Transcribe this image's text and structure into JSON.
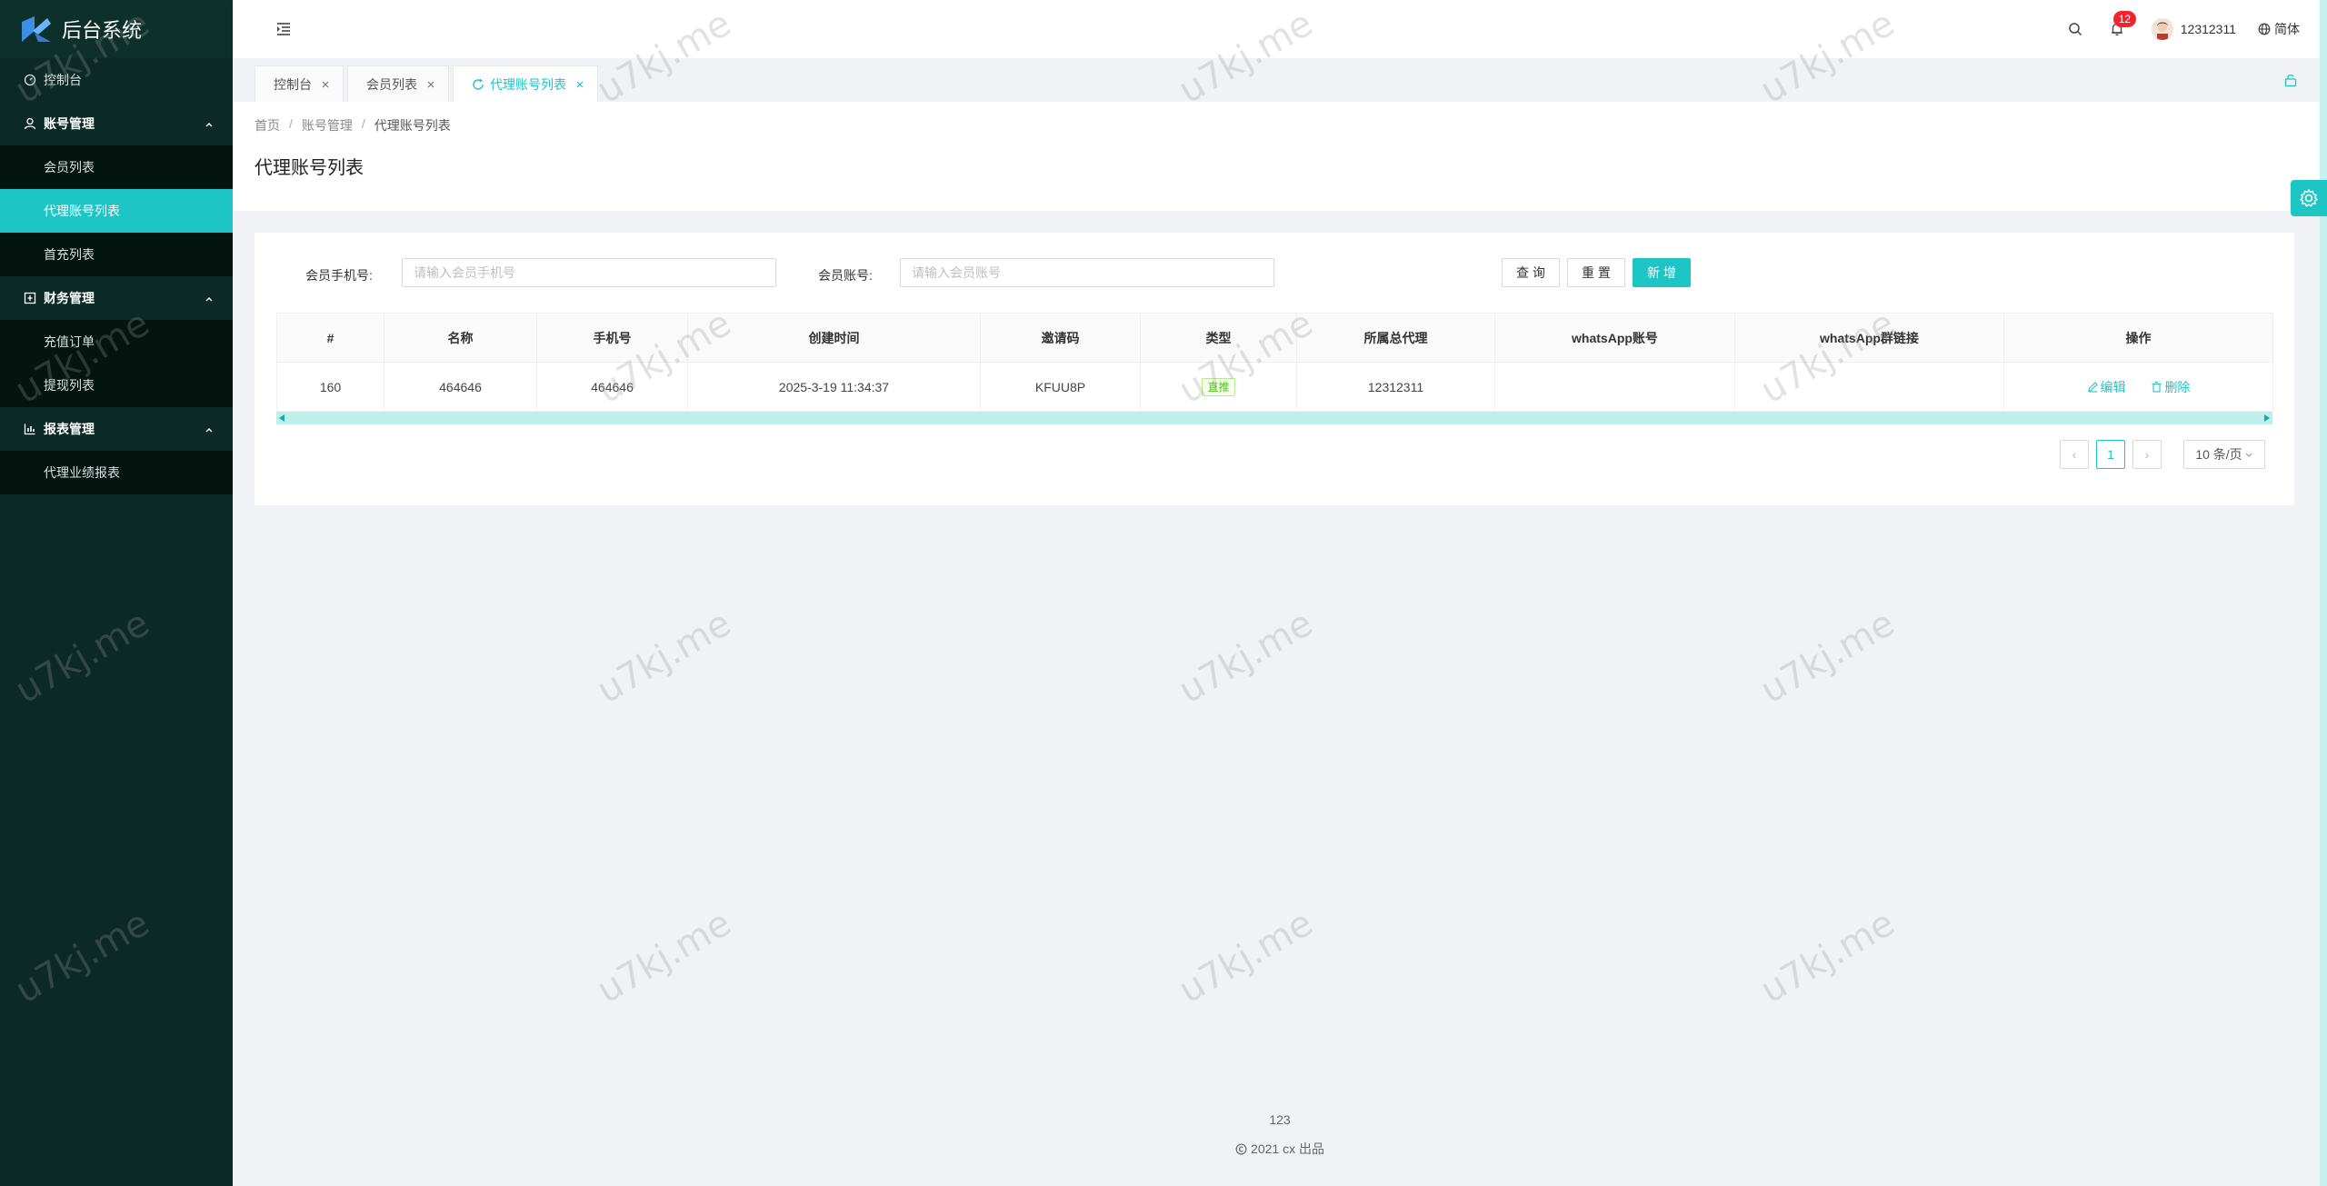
{
  "app": {
    "title": "后台系统"
  },
  "sidebar": {
    "dashboard": "控制台",
    "groups": [
      {
        "label": "账号管理",
        "items": [
          "会员列表",
          "代理账号列表",
          "首充列表"
        ]
      },
      {
        "label": "财务管理",
        "items": [
          "充值订单",
          "提现列表"
        ]
      },
      {
        "label": "报表管理",
        "items": [
          "代理业绩报表"
        ]
      }
    ]
  },
  "header": {
    "notification_count": "12",
    "username": "12312311",
    "language": "简体"
  },
  "tabs": [
    {
      "label": "控制台"
    },
    {
      "label": "会员列表"
    },
    {
      "label": "代理账号列表"
    }
  ],
  "breadcrumb": {
    "home": "首页",
    "section": "账号管理",
    "current": "代理账号列表"
  },
  "page_title": "代理账号列表",
  "search": {
    "phone_label": "会员手机号:",
    "phone_placeholder": "请输入会员手机号",
    "account_label": "会员账号:",
    "account_placeholder": "请输入会员账号",
    "query_label": "查 询",
    "reset_label": "重 置",
    "add_label": "新 增"
  },
  "table": {
    "columns": [
      "#",
      "名称",
      "手机号",
      "创建时间",
      "邀请码",
      "类型",
      "所属总代理",
      "whatsApp账号",
      "whatsApp群链接",
      "操作"
    ],
    "rows": [
      {
        "id": "160",
        "name": "464646",
        "phone": "464646",
        "created": "2025-3-19 11:34:37",
        "invite": "KFUU8P",
        "type": "直推",
        "agent": "12312311",
        "wa_account": "",
        "wa_link": ""
      }
    ],
    "edit_label": "编辑",
    "delete_label": "删除"
  },
  "pagination": {
    "current": "1",
    "page_size": "10 条/页"
  },
  "footer": {
    "links": "123",
    "copyright": "2021 cx 出品"
  },
  "watermark": "u7kj.me",
  "colors": {
    "accent": "#1ec5c5",
    "sidebar_bg": "#0b2a25",
    "badge": "#f5222d"
  }
}
